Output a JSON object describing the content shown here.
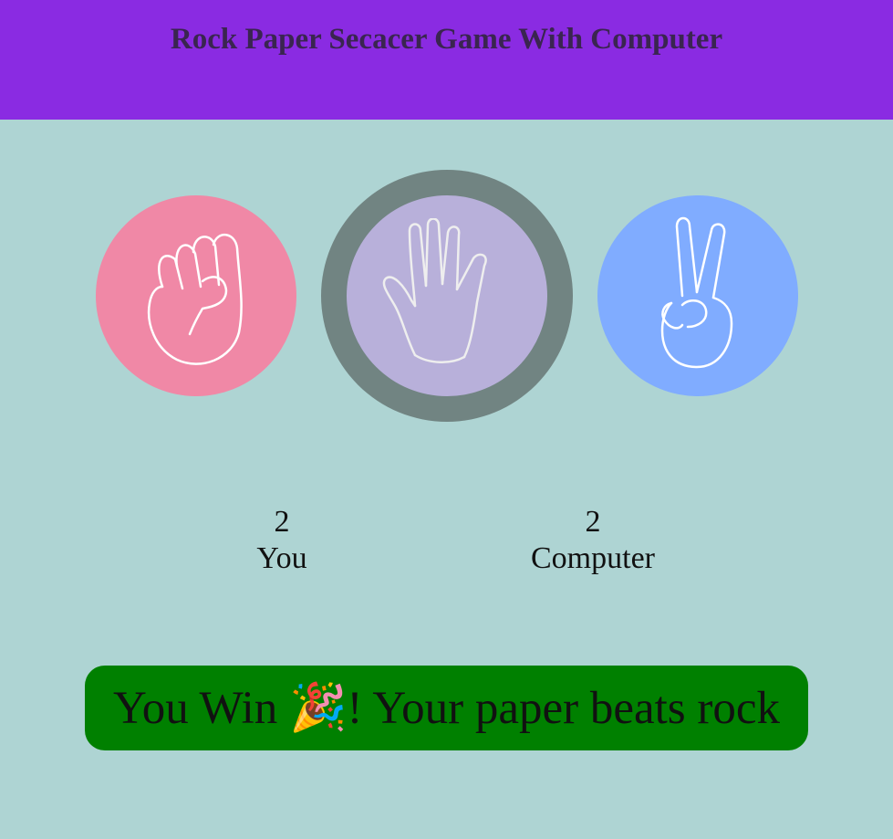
{
  "header": {
    "title": "Rock Paper Secacer Game With Computer"
  },
  "choices": [
    {
      "label": "rock",
      "icon": "fist-icon",
      "color": "#f088a6"
    },
    {
      "label": "paper",
      "icon": "open-hand-icon",
      "color": "#b8b0da",
      "selected": true
    },
    {
      "label": "scissors",
      "icon": "peace-hand-icon",
      "color": "#80acff"
    }
  ],
  "scores": {
    "user": {
      "value": "2",
      "label": "You"
    },
    "computer": {
      "value": "2",
      "label": "Computer"
    }
  },
  "message": {
    "text": "You Win 🎉! Your paper beats rock",
    "color": "#008000"
  },
  "colors": {
    "header_bg": "#8a2be2",
    "page_bg": "#aed4d3",
    "selected_ring": "#718482"
  }
}
